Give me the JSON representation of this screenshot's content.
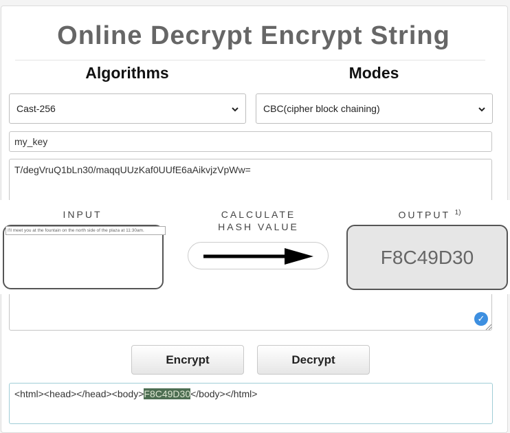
{
  "page": {
    "title": "Online Decrypt Encrypt String"
  },
  "form": {
    "algorithms_label": "Algorithms",
    "modes_label": "Modes",
    "algorithm_selected": "Cast-256",
    "mode_selected": "CBC(cipher block chaining)",
    "key_value": "my_key",
    "input_text": "T/degVruQ1bLn30/maqqUUzKaf0UUfE6aAikvjzVpWw=",
    "encrypt_label": "Encrypt",
    "decrypt_label": "Decrypt",
    "result_prefix": "<html><head></head><body>",
    "result_highlight": "F8C49D30",
    "result_suffix": "</body></html>"
  },
  "overlay": {
    "input_label": "INPUT",
    "calc_label_line1": "CALCULATE",
    "calc_label_line2": "HASH VALUE",
    "output_label": "OUTPUT",
    "output_footnote": "1)",
    "input_text": "I'll meet you at the fountain on the north side of the plaza at 11:30am.",
    "output_value": "F8C49D30"
  },
  "colors": {
    "highlight_bg": "#4d6e52",
    "check_blue": "#3d8fe0",
    "result_border": "#9fcdd6"
  }
}
